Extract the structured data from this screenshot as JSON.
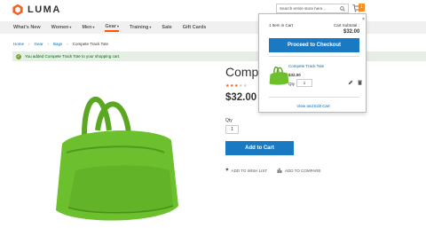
{
  "header": {
    "logo_text": "LUMA",
    "search_placeholder": "Search entire store here...",
    "cart_count": "1"
  },
  "nav": {
    "items": [
      {
        "label": "What's New"
      },
      {
        "label": "Women"
      },
      {
        "label": "Men"
      },
      {
        "label": "Gear"
      },
      {
        "label": "Training"
      },
      {
        "label": "Sale"
      },
      {
        "label": "Gift Cards"
      }
    ]
  },
  "breadcrumb": [
    "Home",
    "Gear",
    "Bags",
    "Compete Track Tote"
  ],
  "message": "You added Compete Track Tote to your shopping cart.",
  "product": {
    "title": "Compete Track Tote",
    "price": "$32.00",
    "qty_label": "Qty",
    "qty_value": "1",
    "add_to_cart": "Add to Cart",
    "wish_list": "ADD TO WISH LIST",
    "compare": "ADD TO COMPARE",
    "rating_stars": 3,
    "rating_max": 5
  },
  "minicart": {
    "close": "×",
    "items_label": "1 Item in Cart",
    "subtotal_label": "Cart Subtotal :",
    "subtotal": "$32.00",
    "checkout": "Proceed to Checkout",
    "item_name": "Compete Track Tote",
    "item_price": "$32.00",
    "qty_label": "Qty",
    "qty_value": "1",
    "view_edit": "View and Edit Cart"
  },
  "colors": {
    "accent": "#1979c3",
    "brand_orange": "#ff5501",
    "bag_green": "#6cc02e",
    "success_bg": "#e5efe5"
  }
}
